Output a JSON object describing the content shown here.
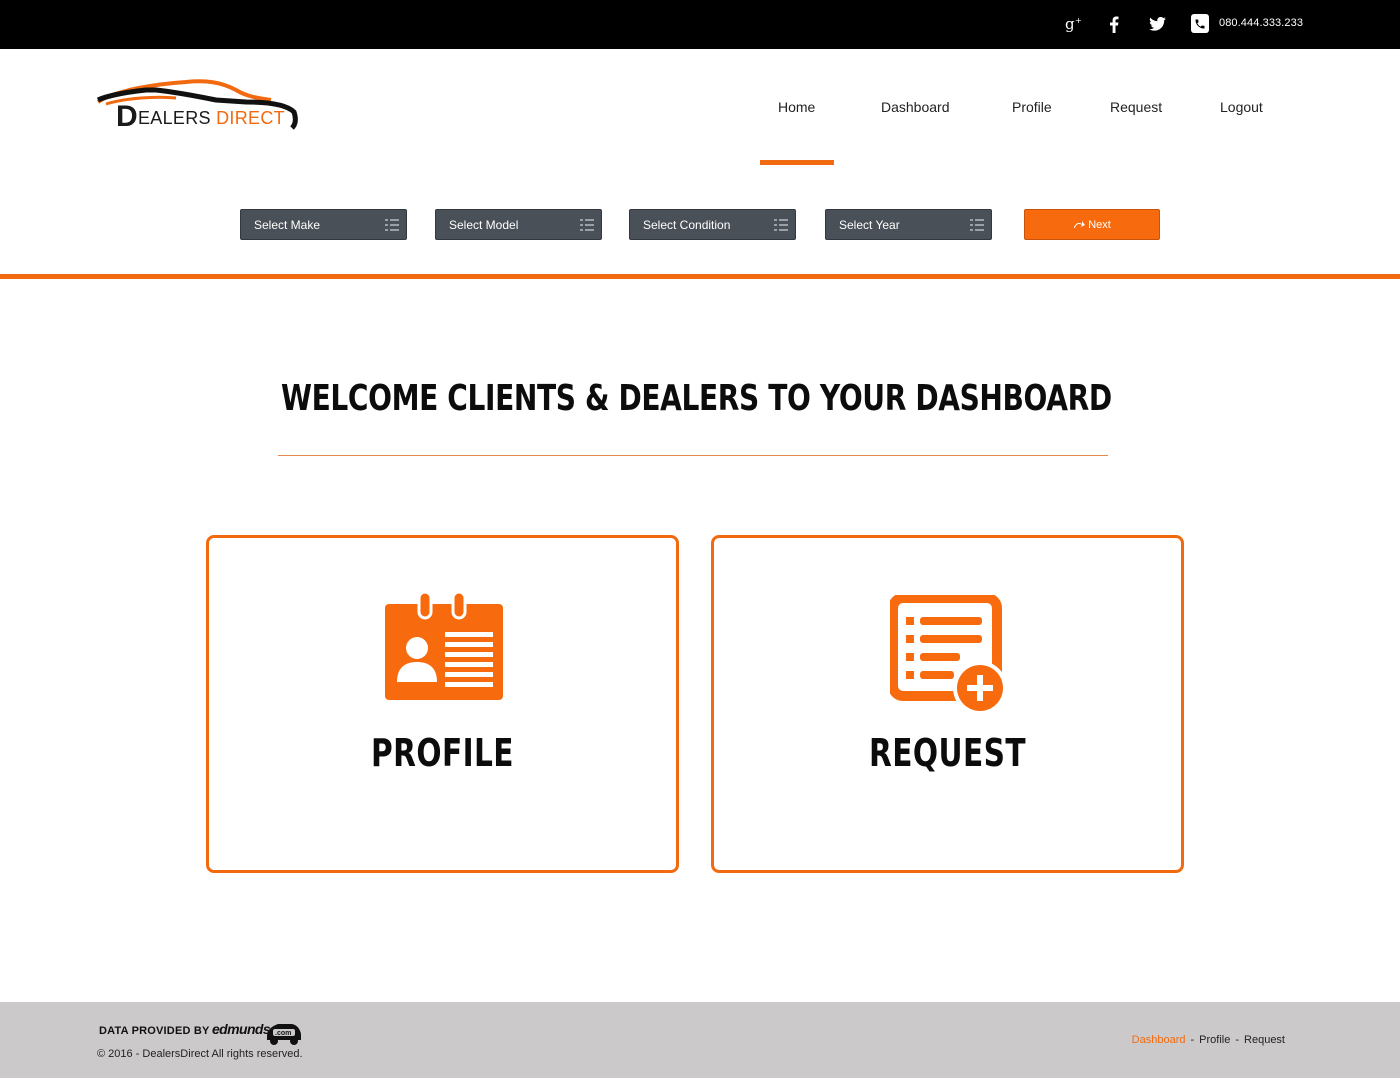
{
  "topbar": {
    "social": [
      "google-plus-icon",
      "facebook-icon",
      "twitter-icon"
    ],
    "phone": "080.444.333.233"
  },
  "brand": {
    "logo_first_letter": "D",
    "logo_rest": "EALERS",
    "logo_accent": "DIRECT",
    "accent_color": "#f26a10"
  },
  "nav": {
    "items": [
      {
        "label": "Home",
        "active": true
      },
      {
        "label": "Dashboard"
      },
      {
        "label": "Profile"
      },
      {
        "label": "Request"
      },
      {
        "label": "Logout"
      }
    ]
  },
  "filters": {
    "make": "Select Make",
    "model": "Select Model",
    "condition": "Select Condition",
    "year": "Select Year",
    "next_label": "Next"
  },
  "main": {
    "welcome": "WELCOME CLIENTS & DEALERS TO YOUR DASHBOARD",
    "cards": [
      {
        "label": "PROFILE",
        "icon": "profile-card-icon"
      },
      {
        "label": "REQUEST",
        "icon": "request-add-icon"
      }
    ]
  },
  "footer": {
    "data_provided": "DATA PROVIDED BY",
    "provider": "edmunds",
    "provider_suffix": ".com",
    "copyright": "© 2016 - DealersDirect All rights reserved.",
    "links": [
      "Dashboard",
      "Profile",
      "Request"
    ]
  }
}
